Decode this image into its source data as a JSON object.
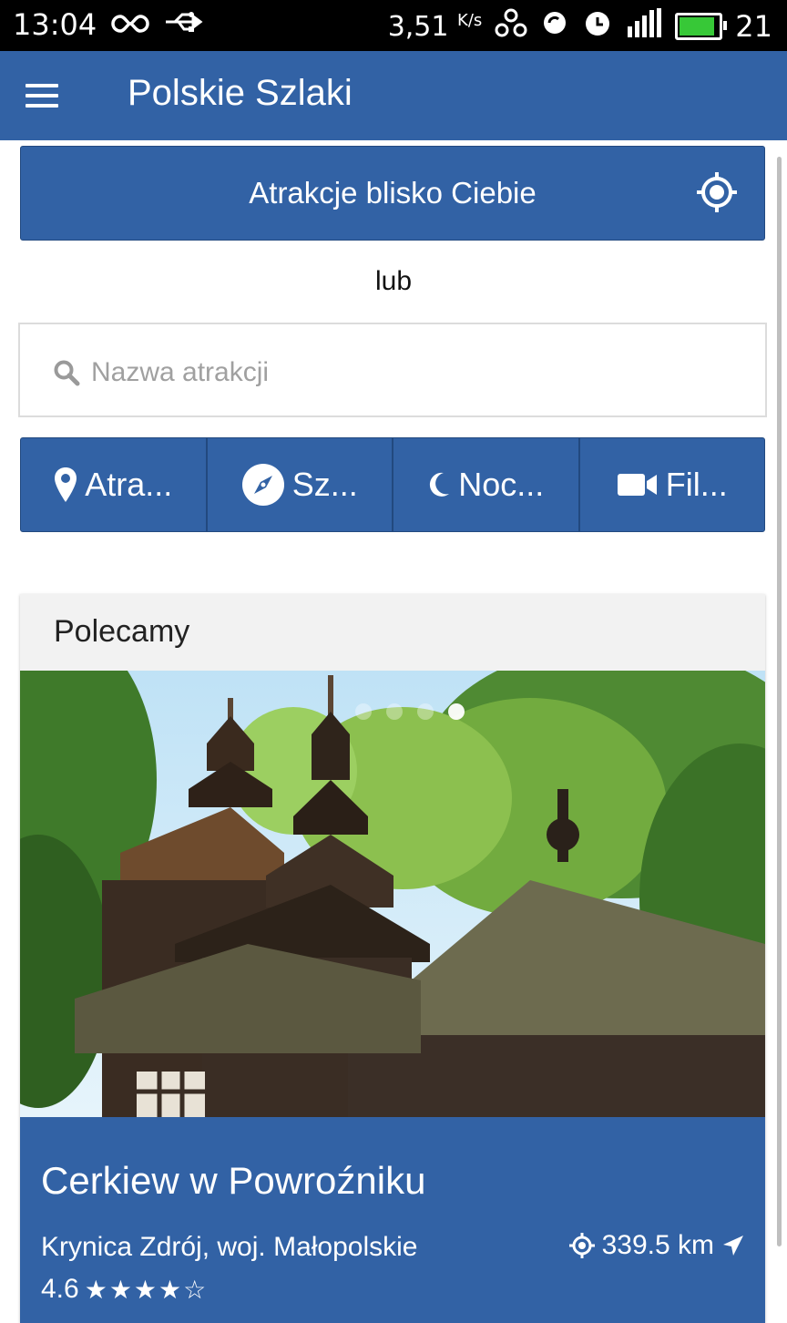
{
  "status_bar": {
    "time": "13:04",
    "speed": "3,51",
    "speed_unit": "K/s",
    "battery": "21",
    "icons": [
      "infinity-icon",
      "usb-icon",
      "network-icon",
      "sync-icon",
      "alarm-icon",
      "signal-icon",
      "battery-icon"
    ]
  },
  "app_bar": {
    "title": "Polskie Szlaki",
    "menu_icon": "hamburger-menu-icon"
  },
  "nearby": {
    "label": "Atrakcje blisko Ciebie",
    "icon": "gps-target-icon"
  },
  "separator": "lub",
  "search": {
    "placeholder": "Nazwa atrakcji",
    "value": ""
  },
  "categories": [
    {
      "label": "Atra...",
      "icon": "map-pin-icon"
    },
    {
      "label": "Sz...",
      "icon": "compass-icon"
    },
    {
      "label": "Noc...",
      "icon": "moon-icon"
    },
    {
      "label": "Fil...",
      "icon": "video-camera-icon"
    }
  ],
  "featured": {
    "header": "Polecamy",
    "image": "wooden-church-photo",
    "slides_total": 4,
    "active_slide": 4,
    "name": "Cerkiew w Powroźniku",
    "location": "Krynica Zdrój, woj. Małopolskie",
    "distance": "339.5 km",
    "rating": "4.6",
    "stars": "★★★★☆",
    "accent": "#3262a5"
  }
}
